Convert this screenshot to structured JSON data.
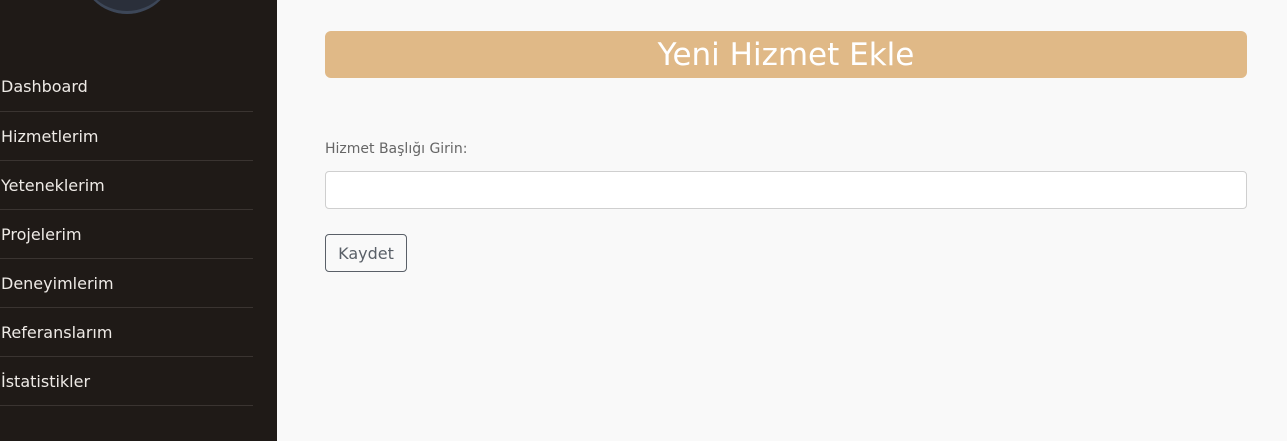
{
  "sidebar": {
    "items": [
      {
        "label": "Dashboard"
      },
      {
        "label": "Hizmetlerim"
      },
      {
        "label": "Yeteneklerim"
      },
      {
        "label": "Projelerim"
      },
      {
        "label": "Deneyimlerim"
      },
      {
        "label": "Referanslarım"
      },
      {
        "label": "İstatistikler"
      }
    ]
  },
  "main": {
    "title": "Yeni Hizmet Ekle",
    "form": {
      "label": "Hizmet Başlığı Girin:",
      "input_value": "",
      "save_label": "Kaydet"
    }
  },
  "colors": {
    "sidebar_bg": "#1f1a17",
    "title_bar": "#e0b987",
    "page_bg": "#f9f9f9"
  }
}
